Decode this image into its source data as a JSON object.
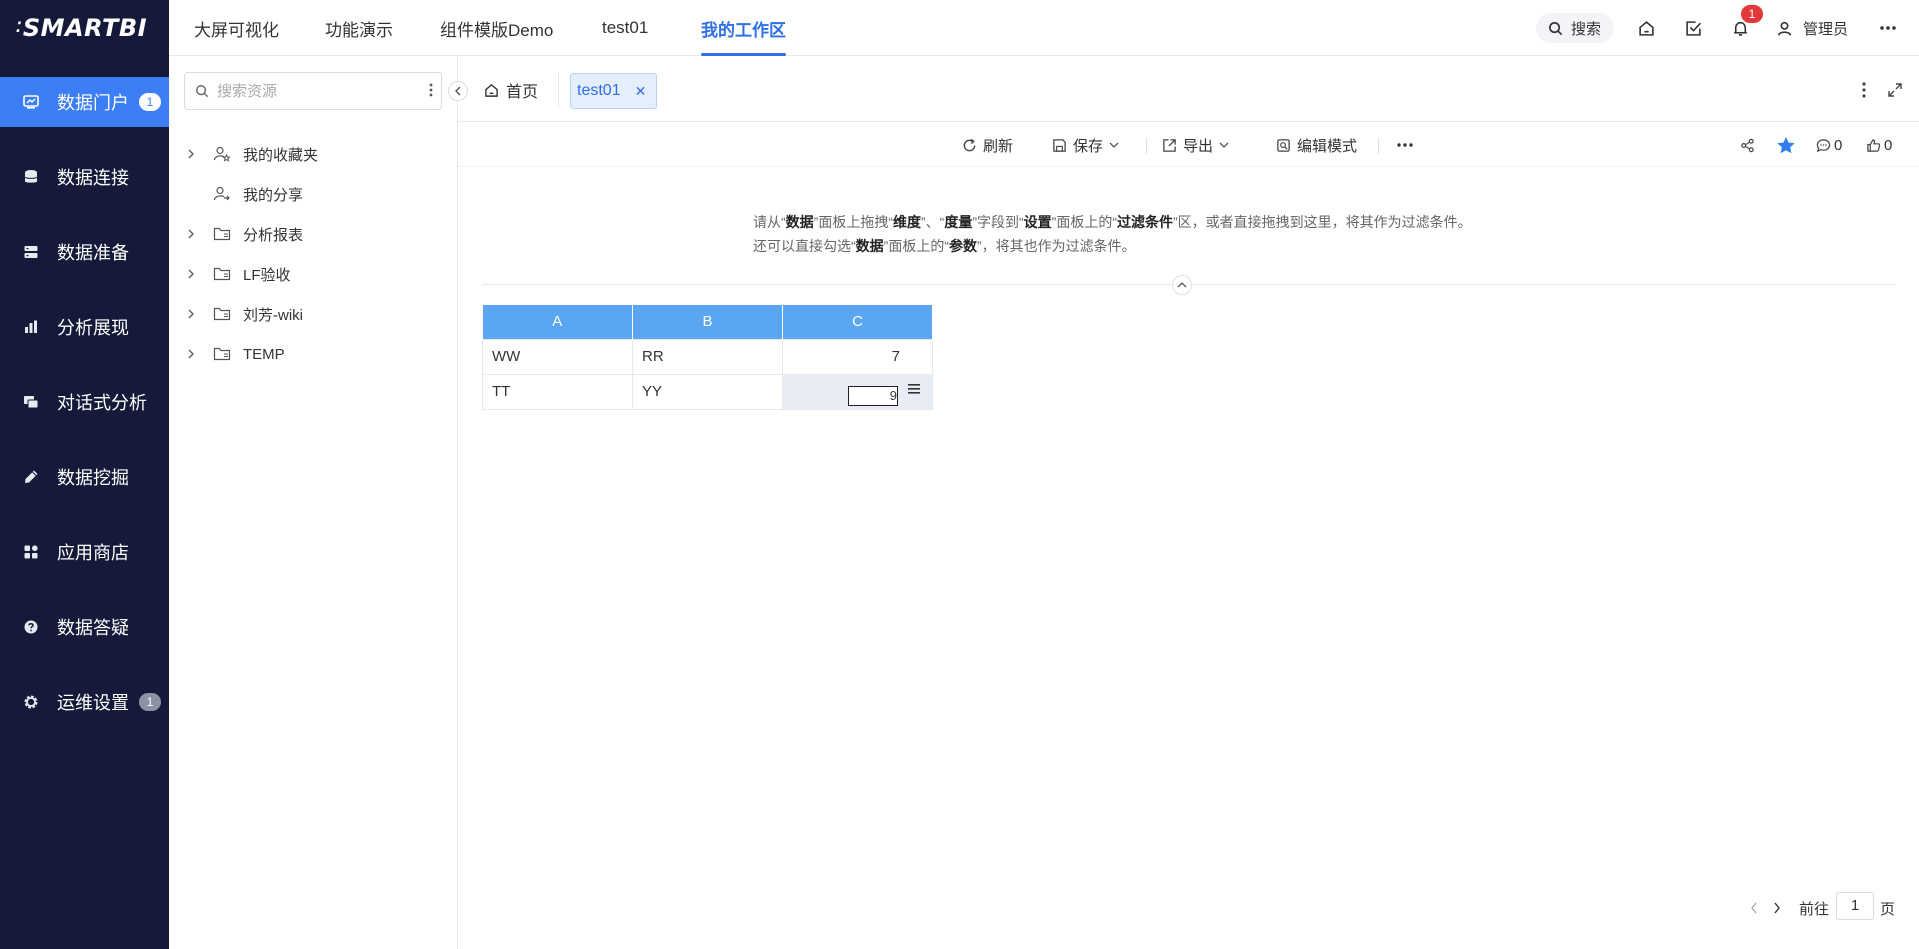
{
  "logo": {
    "text": "SMARTBI",
    "dots": "⁚"
  },
  "leftnav": {
    "items": [
      {
        "label": "数据门户",
        "icon": "chart-icon",
        "badge": "1",
        "active": true
      },
      {
        "label": "数据连接",
        "icon": "database-icon"
      },
      {
        "label": "数据准备",
        "icon": "server-icon"
      },
      {
        "label": "分析展现",
        "icon": "bar-chart-icon"
      },
      {
        "label": "对话式分析",
        "icon": "chat-icon"
      },
      {
        "label": "数据挖掘",
        "icon": "pen-icon"
      },
      {
        "label": "应用商店",
        "icon": "apps-icon"
      },
      {
        "label": "数据答疑",
        "icon": "question-icon"
      },
      {
        "label": "运维设置",
        "icon": "gear-icon",
        "badge": "1"
      }
    ]
  },
  "topnav": {
    "tabs": [
      {
        "label": "大屏可视化"
      },
      {
        "label": "功能演示"
      },
      {
        "label": "组件模版Demo"
      },
      {
        "label": "test01"
      },
      {
        "label": "我的工作区",
        "active": true
      }
    ],
    "search_label": "搜索",
    "notification_count": "1",
    "user_name": "管理员"
  },
  "resource_panel": {
    "search_placeholder": "搜索资源",
    "tree": [
      {
        "label": "我的收藏夹",
        "icon": "user-star-icon",
        "expandable": true
      },
      {
        "label": "我的分享",
        "icon": "user-share-icon",
        "expandable": false
      },
      {
        "label": "分析报表",
        "icon": "folder-icon",
        "expandable": true
      },
      {
        "label": "LF验收",
        "icon": "folder-icon",
        "expandable": true
      },
      {
        "label": "刘芳-wiki",
        "icon": "folder-icon",
        "expandable": true
      },
      {
        "label": "TEMP",
        "icon": "folder-icon",
        "expandable": true
      }
    ]
  },
  "tabbar": {
    "home_label": "首页",
    "doc_tab_label": "test01"
  },
  "toolbar": {
    "refresh": "刷新",
    "save": "保存",
    "export": "导出",
    "edit_mode": "编辑模式",
    "comments_count": "0",
    "likes_count": "0"
  },
  "filter_hint": {
    "line1": [
      {
        "t": "请从“",
        "b": false
      },
      {
        "t": "数据",
        "b": true
      },
      {
        "t": "”面板上拖拽“",
        "b": false
      },
      {
        "t": "维度",
        "b": true
      },
      {
        "t": "”、“",
        "b": false
      },
      {
        "t": "度量",
        "b": true
      },
      {
        "t": "”字段到“",
        "b": false
      },
      {
        "t": "设置",
        "b": true
      },
      {
        "t": "”面板上的“",
        "b": false
      },
      {
        "t": "过滤条件",
        "b": true
      },
      {
        "t": "”区，或者直接拖拽到这里，将其作为过滤条件。",
        "b": false
      }
    ],
    "line2": [
      {
        "t": "还可以直接勾选“",
        "b": false
      },
      {
        "t": "数据",
        "b": true
      },
      {
        "t": "”面板上的“",
        "b": false
      },
      {
        "t": "参数",
        "b": true
      },
      {
        "t": "”，将其也作为过滤条件。",
        "b": false
      }
    ]
  },
  "table": {
    "columns": [
      "A",
      "B",
      "C"
    ],
    "rows": [
      [
        "WW",
        "RR",
        "7"
      ],
      [
        "TT",
        "YY",
        "9"
      ]
    ],
    "editing_value": "9"
  },
  "pager": {
    "goto_label": "前往",
    "page": "1",
    "page_suffix": "页"
  }
}
